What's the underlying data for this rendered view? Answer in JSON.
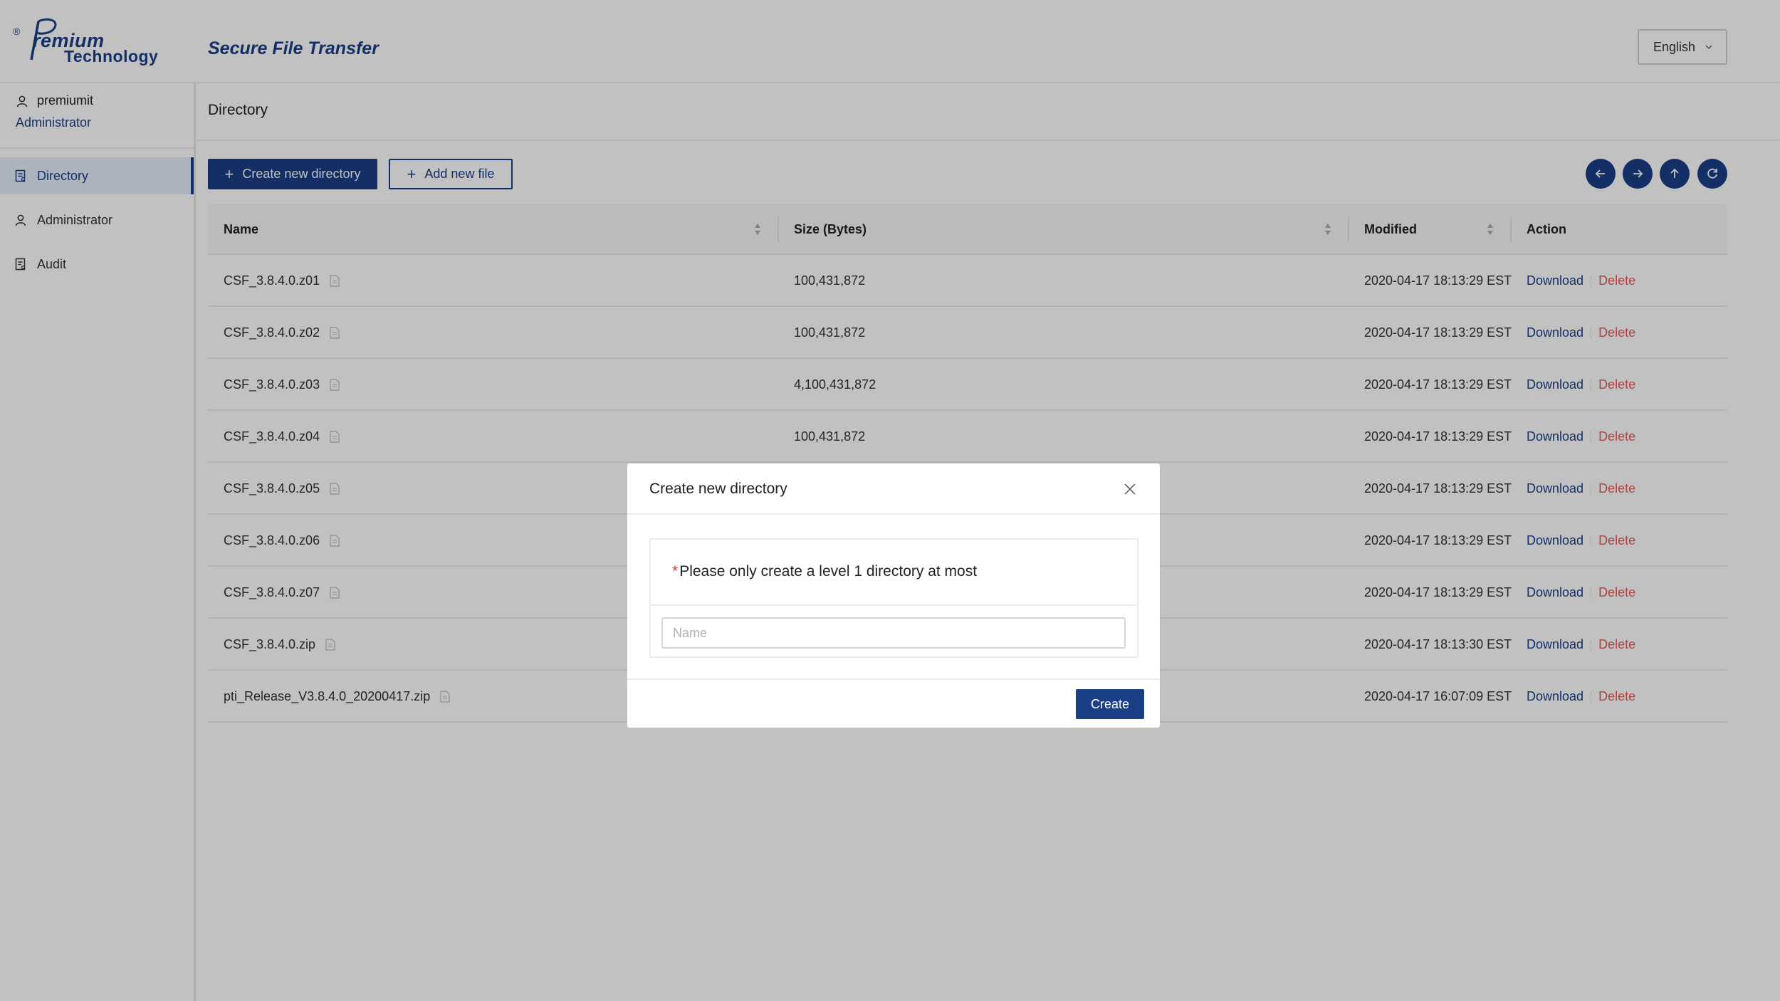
{
  "header": {
    "logo_reg": "®",
    "logo_line1": "remium",
    "logo_line2": "Technology",
    "app_title": "Secure File Transfer",
    "language": "English"
  },
  "sidebar": {
    "username": "premiumit",
    "role": "Administrator",
    "items": [
      {
        "label": "Directory",
        "icon": "directory-icon",
        "active": true
      },
      {
        "label": "Administrator",
        "icon": "user-icon",
        "active": false
      },
      {
        "label": "Audit",
        "icon": "audit-icon",
        "active": false
      }
    ]
  },
  "main": {
    "title": "Directory",
    "create_dir_label": "Create new directory",
    "add_file_label": "Add new file",
    "nav_buttons": [
      "back-arrow-icon",
      "forward-arrow-icon",
      "up-arrow-icon",
      "refresh-icon"
    ]
  },
  "table": {
    "columns": [
      "Name",
      "Size (Bytes)",
      "Modified",
      "Action"
    ],
    "download_label": "Download",
    "delete_label": "Delete",
    "rows": [
      {
        "name": "CSF_3.8.4.0.z01",
        "size": "100,431,872",
        "modified": "2020-04-17 18:13:29 EST"
      },
      {
        "name": "CSF_3.8.4.0.z02",
        "size": "100,431,872",
        "modified": "2020-04-17 18:13:29 EST"
      },
      {
        "name": "CSF_3.8.4.0.z03",
        "size": "4,100,431,872",
        "modified": "2020-04-17 18:13:29 EST"
      },
      {
        "name": "CSF_3.8.4.0.z04",
        "size": "100,431,872",
        "modified": "2020-04-17 18:13:29 EST"
      },
      {
        "name": "CSF_3.8.4.0.z05",
        "size": "",
        "modified": "2020-04-17 18:13:29 EST"
      },
      {
        "name": "CSF_3.8.4.0.z06",
        "size": "",
        "modified": "2020-04-17 18:13:29 EST"
      },
      {
        "name": "CSF_3.8.4.0.z07",
        "size": "",
        "modified": "2020-04-17 18:13:29 EST"
      },
      {
        "name": "CSF_3.8.4.0.zip",
        "size": "",
        "modified": "2020-04-17 18:13:30 EST"
      },
      {
        "name": "pti_Release_V3.8.4.0_20200417.zip",
        "size": "",
        "modified": "2020-04-17 16:07:09 EST"
      }
    ]
  },
  "modal": {
    "title": "Create new directory",
    "required_mark": "*",
    "note": "Please only create a level 1 directory at most",
    "name_placeholder": "Name",
    "name_value": "",
    "create_label": "Create"
  },
  "colors": {
    "brand": "#1b3f87",
    "delete": "#e35a5a",
    "active_nav_bg": "#e2eef9"
  }
}
